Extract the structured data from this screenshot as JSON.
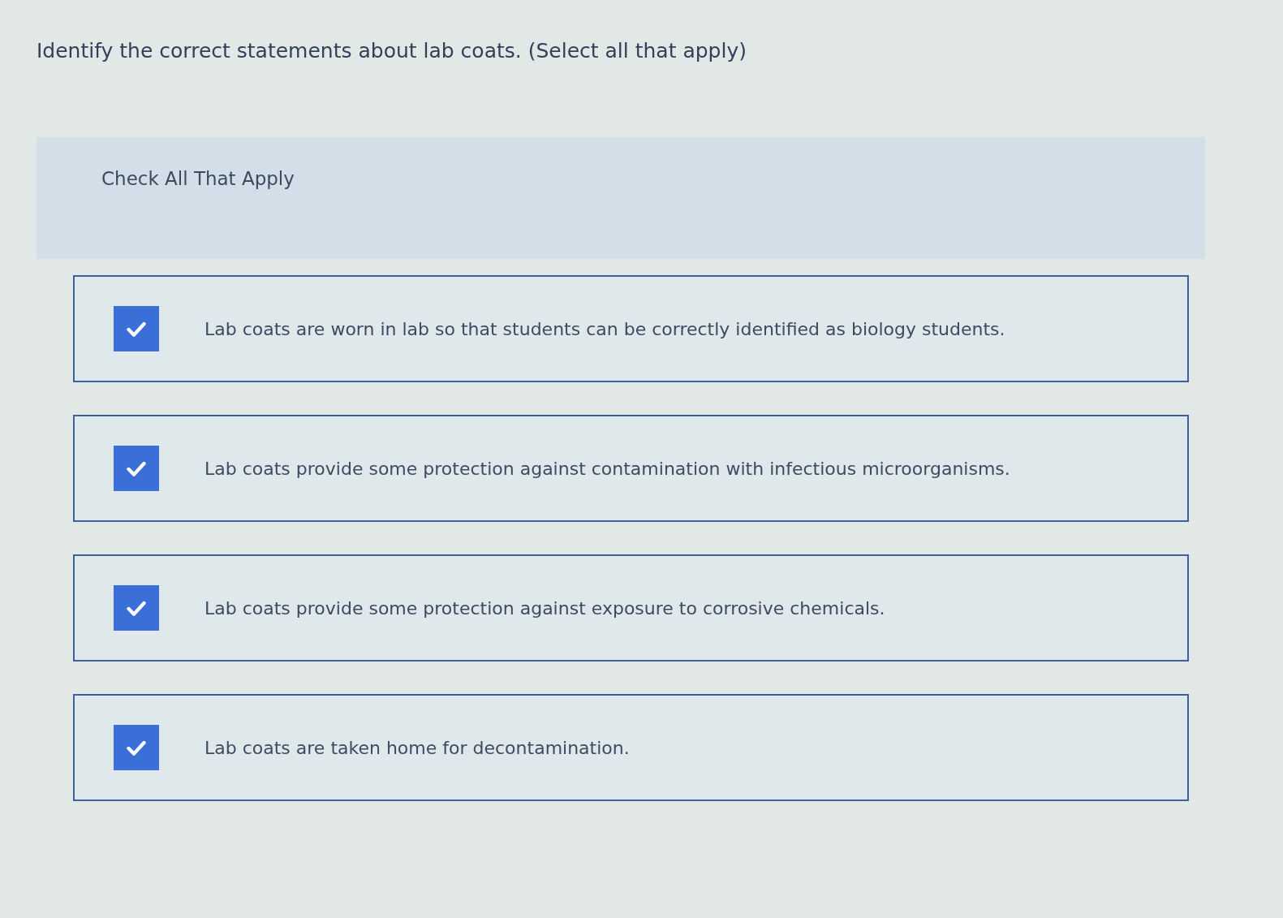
{
  "question": {
    "text": "Identify the correct statements about lab coats. (Select all that apply)"
  },
  "instruction": "Check All That Apply",
  "options": [
    {
      "label": "Lab coats are worn in lab so that students can be correctly identified as biology students.",
      "checked": true
    },
    {
      "label": "Lab coats provide some protection against contamination with infectious microorganisms.",
      "checked": true
    },
    {
      "label": "Lab coats provide some protection against exposure to corrosive chemicals.",
      "checked": true
    },
    {
      "label": "Lab coats are taken home for decontamination.",
      "checked": true
    }
  ]
}
